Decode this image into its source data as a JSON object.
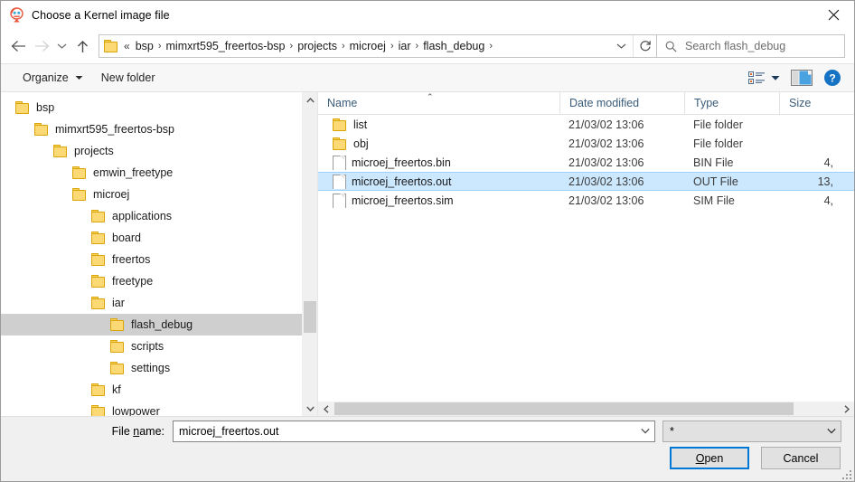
{
  "window": {
    "title": "Choose a Kernel image file",
    "icon": "microej-logo-icon",
    "close_label": "Close"
  },
  "nav": {
    "back": "Back",
    "forward": "Forward",
    "recent": "Recent locations",
    "up": "Up one level",
    "breadcrumb_prefix": "«",
    "breadcrumb": [
      "bsp",
      "mimxrt595_freertos-bsp",
      "projects",
      "microej",
      "iar",
      "flash_debug"
    ],
    "separator": "›",
    "refresh": "Refresh",
    "dropdown": "Previous locations"
  },
  "search": {
    "placeholder": "Search flash_debug",
    "icon": "search-icon"
  },
  "toolbar": {
    "organize_label": "Organize",
    "new_folder_label": "New folder",
    "view_icon": "view-options-icon",
    "preview_icon": "preview-pane-icon",
    "help_icon": "help-icon"
  },
  "tree": {
    "items": [
      {
        "label": "bsp",
        "depth": 0,
        "selected": false
      },
      {
        "label": "mimxrt595_freertos-bsp",
        "depth": 1,
        "selected": false
      },
      {
        "label": "projects",
        "depth": 2,
        "selected": false
      },
      {
        "label": "emwin_freetype",
        "depth": 3,
        "selected": false
      },
      {
        "label": "microej",
        "depth": 3,
        "selected": false
      },
      {
        "label": "applications",
        "depth": 4,
        "selected": false
      },
      {
        "label": "board",
        "depth": 4,
        "selected": false
      },
      {
        "label": "freertos",
        "depth": 4,
        "selected": false
      },
      {
        "label": "freetype",
        "depth": 4,
        "selected": false
      },
      {
        "label": "iar",
        "depth": 4,
        "selected": false
      },
      {
        "label": "flash_debug",
        "depth": 5,
        "selected": true
      },
      {
        "label": "scripts",
        "depth": 5,
        "selected": false
      },
      {
        "label": "settings",
        "depth": 5,
        "selected": false
      },
      {
        "label": "kf",
        "depth": 4,
        "selected": false
      },
      {
        "label": "lowpower",
        "depth": 4,
        "selected": false
      }
    ]
  },
  "filelist": {
    "columns": [
      "Name",
      "Date modified",
      "Type",
      "Size"
    ],
    "sort_column": "Name",
    "sort_caret": "⌃",
    "rows": [
      {
        "name": "list",
        "date": "21/03/02 13:06",
        "type": "File folder",
        "size": "",
        "icon": "folder-icon",
        "selected": false
      },
      {
        "name": "obj",
        "date": "21/03/02 13:06",
        "type": "File folder",
        "size": "",
        "icon": "folder-icon",
        "selected": false
      },
      {
        "name": "microej_freertos.bin",
        "date": "21/03/02 13:06",
        "type": "BIN File",
        "size": "4,",
        "icon": "file-icon",
        "selected": false
      },
      {
        "name": "microej_freertos.out",
        "date": "21/03/02 13:06",
        "type": "OUT File",
        "size": "13,",
        "icon": "file-icon",
        "selected": true
      },
      {
        "name": "microej_freertos.sim",
        "date": "21/03/02 13:06",
        "type": "SIM File",
        "size": "4,",
        "icon": "file-icon",
        "selected": false
      }
    ]
  },
  "footer": {
    "filename_label_pre": "File ",
    "filename_label_accel": "n",
    "filename_label_post": "ame:",
    "filename_value": "microej_freertos.out",
    "filter_value": "*",
    "open_accel": "O",
    "open_post": "pen",
    "cancel_label": "Cancel"
  },
  "colors": {
    "selection_blue": "#cce8ff",
    "selection_border": "#99d1ff",
    "tree_selection_gray": "#cfcfcf",
    "default_button_border": "#0078d7",
    "folder_yellow": "#fcd975",
    "column_header_text": "#3a5c7a"
  }
}
